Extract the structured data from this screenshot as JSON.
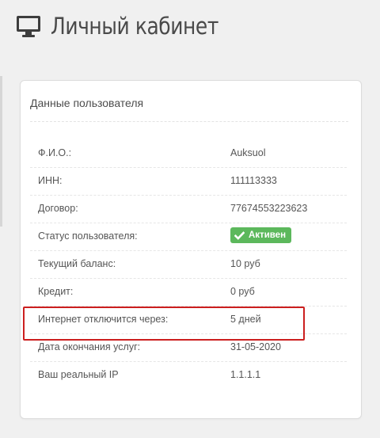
{
  "header": {
    "icon": "monitor-icon",
    "title": "Личный кабинет"
  },
  "panel": {
    "heading": "Данные пользователя",
    "rows": [
      {
        "label": "Ф.И.О.:",
        "value": "Auksuol"
      },
      {
        "label": "ИНН:",
        "value": "111113333"
      },
      {
        "label": "Договор:",
        "value": "77674553223623"
      },
      {
        "label": "Статус пользователя:",
        "value": "Активен"
      },
      {
        "label": "Текущий баланс:",
        "value": "10 руб"
      },
      {
        "label": "Кредит:",
        "value": "0 руб"
      },
      {
        "label": "Интернет отключится через:",
        "value": "5 дней"
      },
      {
        "label": "Дата окончания услуг:",
        "value": "31-05-2020"
      },
      {
        "label": "Ваш реальный IP",
        "value": "1.1.1.1"
      }
    ]
  },
  "colors": {
    "status_active": "#5cb85c",
    "highlight_border": "#cc1f1f"
  }
}
